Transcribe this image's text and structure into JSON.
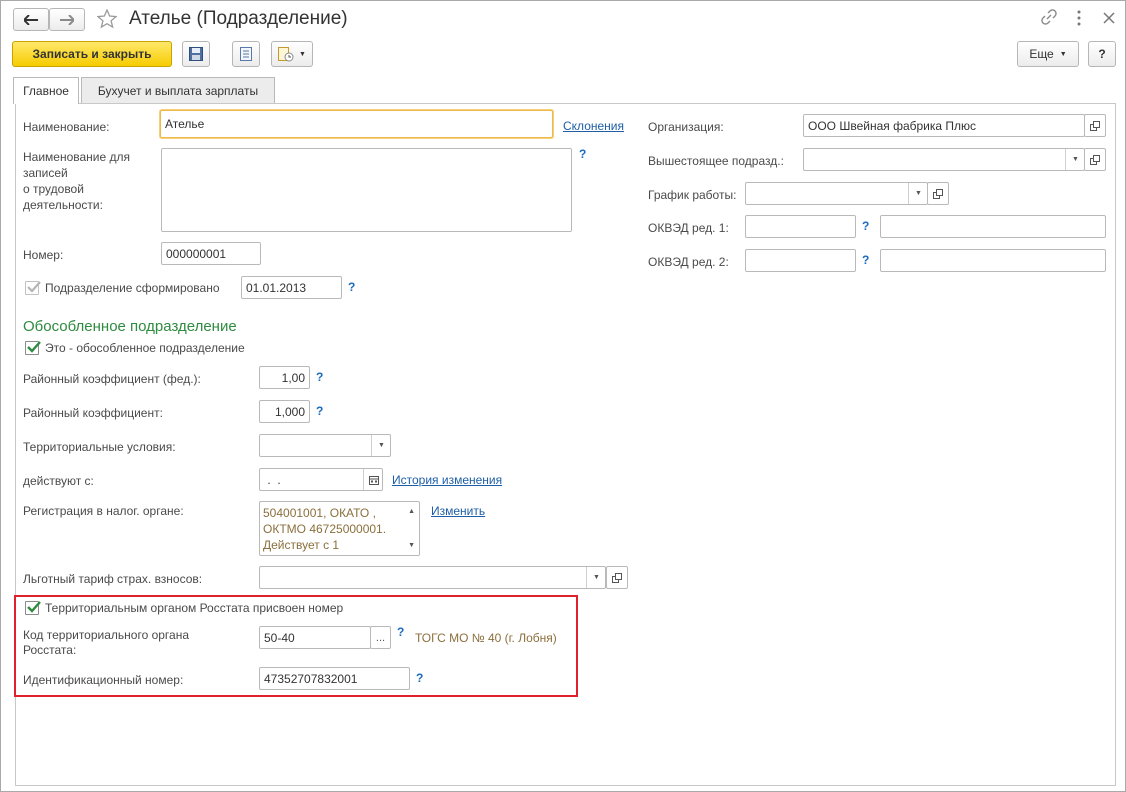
{
  "window": {
    "title": "Ателье (Подразделение)"
  },
  "toolbar": {
    "save_close": "Записать и закрыть",
    "more": "Еще",
    "help": "?"
  },
  "tabs": [
    {
      "label": "Главное"
    },
    {
      "label": "Бухучет и выплата зарплаты"
    }
  ],
  "left": {
    "name_label": "Наименование:",
    "name_value": "Ателье",
    "declension_link": "Склонения",
    "records_label": "Наименование для записей о трудовой деятельности:",
    "records_lines": [
      "Наименование для",
      "записей",
      "о трудовой",
      "деятельности:"
    ],
    "number_label": "Номер:",
    "number_value": "000000001",
    "formed_label": "Подразделение сформировано",
    "formed_date": "01.01.2013",
    "section_title": "Обособленное подразделение",
    "separate_label": "Это - обособленное подразделение",
    "coef_fed_label": "Районный коэффициент (фед.):",
    "coef_fed_value": "1,00",
    "coef_label": "Районный коэффициент:",
    "coef_value": "1,000",
    "terr_label": "Территориальные условия:",
    "terr_value": "",
    "from_label": "действуют с:",
    "from_value": " .  .",
    "history_link": "История изменения",
    "tax_label": "Регистрация в налог. органе:",
    "tax_lines": [
      "504001001, ОКАТО ,",
      "ОКТМО 46725000001.",
      "Действует с 1"
    ],
    "tax_change_link": "Изменить",
    "tariff_label": "Льготный тариф страх. взносов:",
    "tariff_value": "",
    "rosstat_check_label": "Территориальным органом Росстата присвоен номер",
    "rosstat_code_lines": [
      "Код территориального органа",
      "Росстата:"
    ],
    "rosstat_code_value": "50-40",
    "rosstat_code_desc": "ТОГС МО № 40 (г. Лобня)",
    "id_label": "Идентификационный номер:",
    "id_value": "47352707832001"
  },
  "right": {
    "org_label": "Организация:",
    "org_value": "ООО Швейная фабрика Плюс",
    "parent_label": "Вышестоящее подразд.:",
    "parent_value": "",
    "schedule_label": "График работы:",
    "schedule_value": "",
    "okved1_label": "ОКВЭД ред. 1:",
    "okved2_label": "ОКВЭД ред. 2:"
  },
  "help_mark": "?",
  "colors": {
    "accent": "#f6cc00",
    "link": "#1d5ea6",
    "section": "#2e8b3f",
    "highlight": "#e0202a"
  }
}
